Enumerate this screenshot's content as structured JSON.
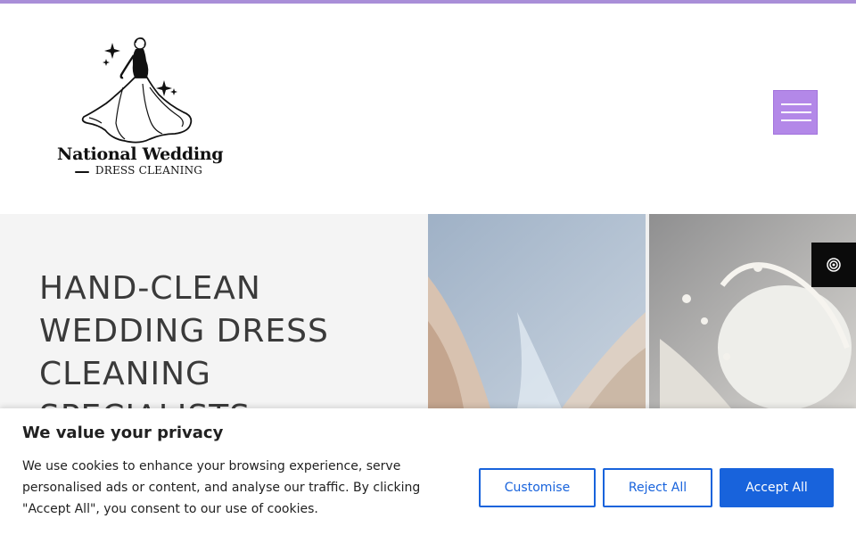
{
  "brand": {
    "name_line1": "National Wedding",
    "name_line2": "DRESS CLEANING",
    "accent_color": "#b388e8",
    "top_bar_color": "#a98ed8"
  },
  "header": {
    "menu_icon": "hamburger-icon"
  },
  "hero": {
    "title": "HAND-CLEAN WEDDING DRESS CLEANING SPECIALISTS",
    "image_icon": "wedding-dress-fabric-photo"
  },
  "accessibility": {
    "icon": "accessibility-icon"
  },
  "cookie_banner": {
    "title": "We value your privacy",
    "text": "We use cookies to enhance your browsing experience, serve personalised ads or content, and analyse our traffic. By clicking \"Accept All\", you consent to our use of cookies.",
    "customise_label": "Customise",
    "reject_label": "Reject All",
    "accept_label": "Accept All",
    "button_color": "#1863dc"
  }
}
